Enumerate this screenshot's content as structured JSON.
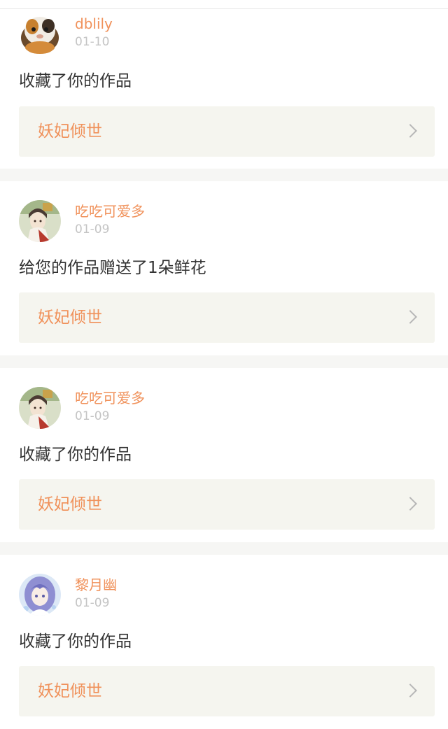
{
  "notifications": [
    {
      "user": "dblily",
      "date": "01-10",
      "avatar_icon": "guinea-pig-avatar",
      "action": "收藏了你的作品",
      "work_title": "妖妃倾世"
    },
    {
      "user": "吃吃可爱多",
      "date": "01-09",
      "avatar_icon": "anime-girl-avatar",
      "action": "给您的作品赠送了1朵鲜花",
      "work_title": "妖妃倾世"
    },
    {
      "user": "吃吃可爱多",
      "date": "01-09",
      "avatar_icon": "anime-girl-avatar",
      "action": "收藏了你的作品",
      "work_title": "妖妃倾世"
    },
    {
      "user": "黎月幽",
      "date": "01-09",
      "avatar_icon": "anime-purple-hair-avatar",
      "action": "收藏了你的作品",
      "work_title": "妖妃倾世"
    }
  ],
  "colors": {
    "accent": "#f0915a",
    "text": "#333333",
    "muted": "#c4c4c4",
    "link_bg": "#f5f5ef",
    "separator": "#f6f6f4"
  }
}
